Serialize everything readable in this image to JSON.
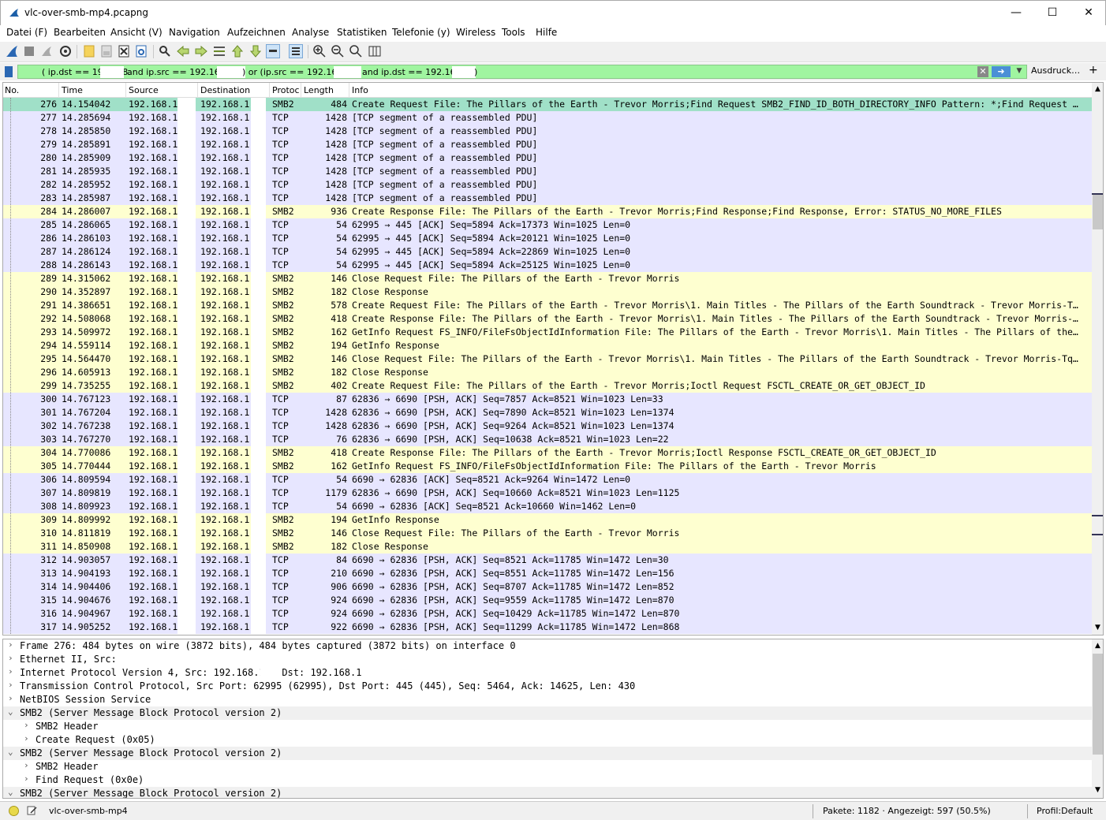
{
  "window": {
    "title": "vlc-over-smb-mp4.pcapng"
  },
  "menu": [
    "Datei (F)",
    "Bearbeiten",
    "Ansicht (V)",
    "Navigation",
    "Aufzeichnen",
    "Analyse",
    "Statistiken",
    "Telefonie (y)",
    "Wireless",
    "Tools",
    "Hilfe"
  ],
  "filter": {
    "seg1": "( ip.dst == 192.168.",
    "seg2": "and ip.src == 192.168.",
    "seg3": ") or (ip.src == 192.168",
    "seg4": "and ip.dst == 192.168.",
    "seg5": ")",
    "ausdruck": "Ausdruck…",
    "plus": "+"
  },
  "columns": {
    "no": "No.",
    "time": "Time",
    "source": "Source",
    "destination": "Destination",
    "protocol": "Protoc",
    "length": "Length",
    "info": "Info"
  },
  "packets": [
    {
      "no": "276",
      "time": "14.154042",
      "src": "192.168.1",
      "dst": "192.168.1",
      "proto": "SMB2",
      "len": "484",
      "info": "Create Request File: The Pillars of the Earth - Trevor Morris;Find Request SMB2_FIND_ID_BOTH_DIRECTORY_INFO Pattern: *;Find Request …",
      "cls": "sel"
    },
    {
      "no": "277",
      "time": "14.285694",
      "src": "192.168.1",
      "dst": "192.168.1",
      "proto": "TCP",
      "len": "1428",
      "info": "[TCP segment of a reassembled PDU]",
      "cls": "tcp"
    },
    {
      "no": "278",
      "time": "14.285850",
      "src": "192.168.1",
      "dst": "192.168.1",
      "proto": "TCP",
      "len": "1428",
      "info": "[TCP segment of a reassembled PDU]",
      "cls": "tcp"
    },
    {
      "no": "279",
      "time": "14.285891",
      "src": "192.168.1",
      "dst": "192.168.1",
      "proto": "TCP",
      "len": "1428",
      "info": "[TCP segment of a reassembled PDU]",
      "cls": "tcp"
    },
    {
      "no": "280",
      "time": "14.285909",
      "src": "192.168.1",
      "dst": "192.168.1",
      "proto": "TCP",
      "len": "1428",
      "info": "[TCP segment of a reassembled PDU]",
      "cls": "tcp"
    },
    {
      "no": "281",
      "time": "14.285935",
      "src": "192.168.1",
      "dst": "192.168.1",
      "proto": "TCP",
      "len": "1428",
      "info": "[TCP segment of a reassembled PDU]",
      "cls": "tcp"
    },
    {
      "no": "282",
      "time": "14.285952",
      "src": "192.168.1",
      "dst": "192.168.1",
      "proto": "TCP",
      "len": "1428",
      "info": "[TCP segment of a reassembled PDU]",
      "cls": "tcp"
    },
    {
      "no": "283",
      "time": "14.285987",
      "src": "192.168.1",
      "dst": "192.168.1",
      "proto": "TCP",
      "len": "1428",
      "info": "[TCP segment of a reassembled PDU]",
      "cls": "tcp"
    },
    {
      "no": "284",
      "time": "14.286007",
      "src": "192.168.1",
      "dst": "192.168.1",
      "proto": "SMB2",
      "len": "936",
      "info": "Create Response File: The Pillars of the Earth - Trevor Morris;Find Response;Find Response, Error: STATUS_NO_MORE_FILES",
      "cls": "smb"
    },
    {
      "no": "285",
      "time": "14.286065",
      "src": "192.168.1",
      "dst": "192.168.1",
      "proto": "TCP",
      "len": "54",
      "info": "62995 → 445 [ACK] Seq=5894 Ack=17373 Win=1025 Len=0",
      "cls": "tcp"
    },
    {
      "no": "286",
      "time": "14.286103",
      "src": "192.168.1",
      "dst": "192.168.1",
      "proto": "TCP",
      "len": "54",
      "info": "62995 → 445 [ACK] Seq=5894 Ack=20121 Win=1025 Len=0",
      "cls": "tcp"
    },
    {
      "no": "287",
      "time": "14.286124",
      "src": "192.168.1",
      "dst": "192.168.1",
      "proto": "TCP",
      "len": "54",
      "info": "62995 → 445 [ACK] Seq=5894 Ack=22869 Win=1025 Len=0",
      "cls": "tcp"
    },
    {
      "no": "288",
      "time": "14.286143",
      "src": "192.168.1",
      "dst": "192.168.1",
      "proto": "TCP",
      "len": "54",
      "info": "62995 → 445 [ACK] Seq=5894 Ack=25125 Win=1025 Len=0",
      "cls": "tcp"
    },
    {
      "no": "289",
      "time": "14.315062",
      "src": "192.168.1",
      "dst": "192.168.1",
      "proto": "SMB2",
      "len": "146",
      "info": "Close Request File: The Pillars of the Earth - Trevor Morris",
      "cls": "smb"
    },
    {
      "no": "290",
      "time": "14.352897",
      "src": "192.168.1",
      "dst": "192.168.1",
      "proto": "SMB2",
      "len": "182",
      "info": "Close Response",
      "cls": "smb"
    },
    {
      "no": "291",
      "time": "14.386651",
      "src": "192.168.1",
      "dst": "192.168.1",
      "proto": "SMB2",
      "len": "578",
      "info": "Create Request File: The Pillars of the Earth - Trevor Morris\\1. Main Titles - The Pillars of the Earth Soundtrack - Trevor Morris-T…",
      "cls": "smb"
    },
    {
      "no": "292",
      "time": "14.508068",
      "src": "192.168.1",
      "dst": "192.168.1",
      "proto": "SMB2",
      "len": "418",
      "info": "Create Response File: The Pillars of the Earth - Trevor Morris\\1. Main Titles - The Pillars of the Earth Soundtrack - Trevor Morris-…",
      "cls": "smb"
    },
    {
      "no": "293",
      "time": "14.509972",
      "src": "192.168.1",
      "dst": "192.168.1",
      "proto": "SMB2",
      "len": "162",
      "info": "GetInfo Request FS_INFO/FileFsObjectIdInformation File: The Pillars of the Earth - Trevor Morris\\1. Main Titles - The Pillars of the…",
      "cls": "smb"
    },
    {
      "no": "294",
      "time": "14.559114",
      "src": "192.168.1",
      "dst": "192.168.1",
      "proto": "SMB2",
      "len": "194",
      "info": "GetInfo Response",
      "cls": "smb"
    },
    {
      "no": "295",
      "time": "14.564470",
      "src": "192.168.1",
      "dst": "192.168.1",
      "proto": "SMB2",
      "len": "146",
      "info": "Close Request File: The Pillars of the Earth - Trevor Morris\\1. Main Titles - The Pillars of the Earth Soundtrack - Trevor Morris-Tq…",
      "cls": "smb"
    },
    {
      "no": "296",
      "time": "14.605913",
      "src": "192.168.1",
      "dst": "192.168.1",
      "proto": "SMB2",
      "len": "182",
      "info": "Close Response",
      "cls": "smb"
    },
    {
      "no": "299",
      "time": "14.735255",
      "src": "192.168.1",
      "dst": "192.168.1",
      "proto": "SMB2",
      "len": "402",
      "info": "Create Request File: The Pillars of the Earth - Trevor Morris;Ioctl Request FSCTL_CREATE_OR_GET_OBJECT_ID",
      "cls": "smb"
    },
    {
      "no": "300",
      "time": "14.767123",
      "src": "192.168.1",
      "dst": "192.168.1",
      "proto": "TCP",
      "len": "87",
      "info": "62836 → 6690 [PSH, ACK] Seq=7857 Ack=8521 Win=1023 Len=33",
      "cls": "tcp"
    },
    {
      "no": "301",
      "time": "14.767204",
      "src": "192.168.1",
      "dst": "192.168.1",
      "proto": "TCP",
      "len": "1428",
      "info": "62836 → 6690 [PSH, ACK] Seq=7890 Ack=8521 Win=1023 Len=1374",
      "cls": "tcp"
    },
    {
      "no": "302",
      "time": "14.767238",
      "src": "192.168.1",
      "dst": "192.168.1",
      "proto": "TCP",
      "len": "1428",
      "info": "62836 → 6690 [PSH, ACK] Seq=9264 Ack=8521 Win=1023 Len=1374",
      "cls": "tcp"
    },
    {
      "no": "303",
      "time": "14.767270",
      "src": "192.168.1",
      "dst": "192.168.1",
      "proto": "TCP",
      "len": "76",
      "info": "62836 → 6690 [PSH, ACK] Seq=10638 Ack=8521 Win=1023 Len=22",
      "cls": "tcp"
    },
    {
      "no": "304",
      "time": "14.770086",
      "src": "192.168.1",
      "dst": "192.168.1",
      "proto": "SMB2",
      "len": "418",
      "info": "Create Response File: The Pillars of the Earth - Trevor Morris;Ioctl Response FSCTL_CREATE_OR_GET_OBJECT_ID",
      "cls": "smb"
    },
    {
      "no": "305",
      "time": "14.770444",
      "src": "192.168.1",
      "dst": "192.168.1",
      "proto": "SMB2",
      "len": "162",
      "info": "GetInfo Request FS_INFO/FileFsObjectIdInformation File: The Pillars of the Earth - Trevor Morris",
      "cls": "smb"
    },
    {
      "no": "306",
      "time": "14.809594",
      "src": "192.168.1",
      "dst": "192.168.1",
      "proto": "TCP",
      "len": "54",
      "info": "6690 → 62836 [ACK] Seq=8521 Ack=9264 Win=1472 Len=0",
      "cls": "tcp"
    },
    {
      "no": "307",
      "time": "14.809819",
      "src": "192.168.1",
      "dst": "192.168.1",
      "proto": "TCP",
      "len": "1179",
      "info": "62836 → 6690 [PSH, ACK] Seq=10660 Ack=8521 Win=1023 Len=1125",
      "cls": "tcp"
    },
    {
      "no": "308",
      "time": "14.809923",
      "src": "192.168.1",
      "dst": "192.168.1",
      "proto": "TCP",
      "len": "54",
      "info": "6690 → 62836 [ACK] Seq=8521 Ack=10660 Win=1462 Len=0",
      "cls": "tcp"
    },
    {
      "no": "309",
      "time": "14.809992",
      "src": "192.168.1",
      "dst": "192.168.1",
      "proto": "SMB2",
      "len": "194",
      "info": "GetInfo Response",
      "cls": "smb"
    },
    {
      "no": "310",
      "time": "14.811819",
      "src": "192.168.1",
      "dst": "192.168.1",
      "proto": "SMB2",
      "len": "146",
      "info": "Close Request File: The Pillars of the Earth - Trevor Morris",
      "cls": "smb"
    },
    {
      "no": "311",
      "time": "14.850908",
      "src": "192.168.1",
      "dst": "192.168.1",
      "proto": "SMB2",
      "len": "182",
      "info": "Close Response",
      "cls": "smb"
    },
    {
      "no": "312",
      "time": "14.903057",
      "src": "192.168.1",
      "dst": "192.168.1",
      "proto": "TCP",
      "len": "84",
      "info": "6690 → 62836 [PSH, ACK] Seq=8521 Ack=11785 Win=1472 Len=30",
      "cls": "tcp"
    },
    {
      "no": "313",
      "time": "14.904193",
      "src": "192.168.1",
      "dst": "192.168.1",
      "proto": "TCP",
      "len": "210",
      "info": "6690 → 62836 [PSH, ACK] Seq=8551 Ack=11785 Win=1472 Len=156",
      "cls": "tcp"
    },
    {
      "no": "314",
      "time": "14.904406",
      "src": "192.168.1",
      "dst": "192.168.1",
      "proto": "TCP",
      "len": "906",
      "info": "6690 → 62836 [PSH, ACK] Seq=8707 Ack=11785 Win=1472 Len=852",
      "cls": "tcp"
    },
    {
      "no": "315",
      "time": "14.904676",
      "src": "192.168.1",
      "dst": "192.168.1",
      "proto": "TCP",
      "len": "924",
      "info": "6690 → 62836 [PSH, ACK] Seq=9559 Ack=11785 Win=1472 Len=870",
      "cls": "tcp"
    },
    {
      "no": "316",
      "time": "14.904967",
      "src": "192.168.1",
      "dst": "192.168.1",
      "proto": "TCP",
      "len": "924",
      "info": "6690 → 62836 [PSH, ACK] Seq=10429 Ack=11785 Win=1472 Len=870",
      "cls": "tcp"
    },
    {
      "no": "317",
      "time": "14.905252",
      "src": "192.168.1",
      "dst": "192.168.1",
      "proto": "TCP",
      "len": "922",
      "info": "6690 → 62836 [PSH, ACK] Seq=11299 Ack=11785 Win=1472 Len=868",
      "cls": "tcp"
    }
  ],
  "details": [
    {
      "text": "Frame 276: 484 bytes on wire (3872 bits), 484 bytes captured (3872 bits) on interface 0",
      "indent": 0,
      "arrow": "›"
    },
    {
      "text": "Ethernet II, Src:                                    , Dst:",
      "indent": 0,
      "arrow": "›"
    },
    {
      "text": "Internet Protocol Version 4, Src: 192.168.1    , Dst: 192.168.1",
      "indent": 0,
      "arrow": "›"
    },
    {
      "text": "Transmission Control Protocol, Src Port: 62995 (62995), Dst Port: 445 (445), Seq: 5464, Ack: 14625, Len: 430",
      "indent": 0,
      "arrow": "›"
    },
    {
      "text": "NetBIOS Session Service",
      "indent": 0,
      "arrow": "›"
    },
    {
      "text": "SMB2 (Server Message Block Protocol version 2)",
      "indent": 0,
      "arrow": "⌄",
      "hl": true
    },
    {
      "text": "SMB2 Header",
      "indent": 1,
      "arrow": "›"
    },
    {
      "text": "Create Request (0x05)",
      "indent": 1,
      "arrow": "›"
    },
    {
      "text": "SMB2 (Server Message Block Protocol version 2)",
      "indent": 0,
      "arrow": "⌄",
      "hl": true
    },
    {
      "text": "SMB2 Header",
      "indent": 1,
      "arrow": "›"
    },
    {
      "text": "Find Request (0x0e)",
      "indent": 1,
      "arrow": "›"
    },
    {
      "text": "SMB2 (Server Message Block Protocol version 2)",
      "indent": 0,
      "arrow": "⌄",
      "hl": true
    }
  ],
  "status": {
    "file": "vlc-over-smb-mp4",
    "packets": "Pakete: 1182 · Angezeigt: 597 (50.5%)",
    "profile": "Profil:Default"
  },
  "colors": {
    "tcp_row": "#e7e6ff",
    "smb_row": "#feffd0",
    "selected_row": "#a0e0c8",
    "filter_bg": "#a0f5a0"
  }
}
